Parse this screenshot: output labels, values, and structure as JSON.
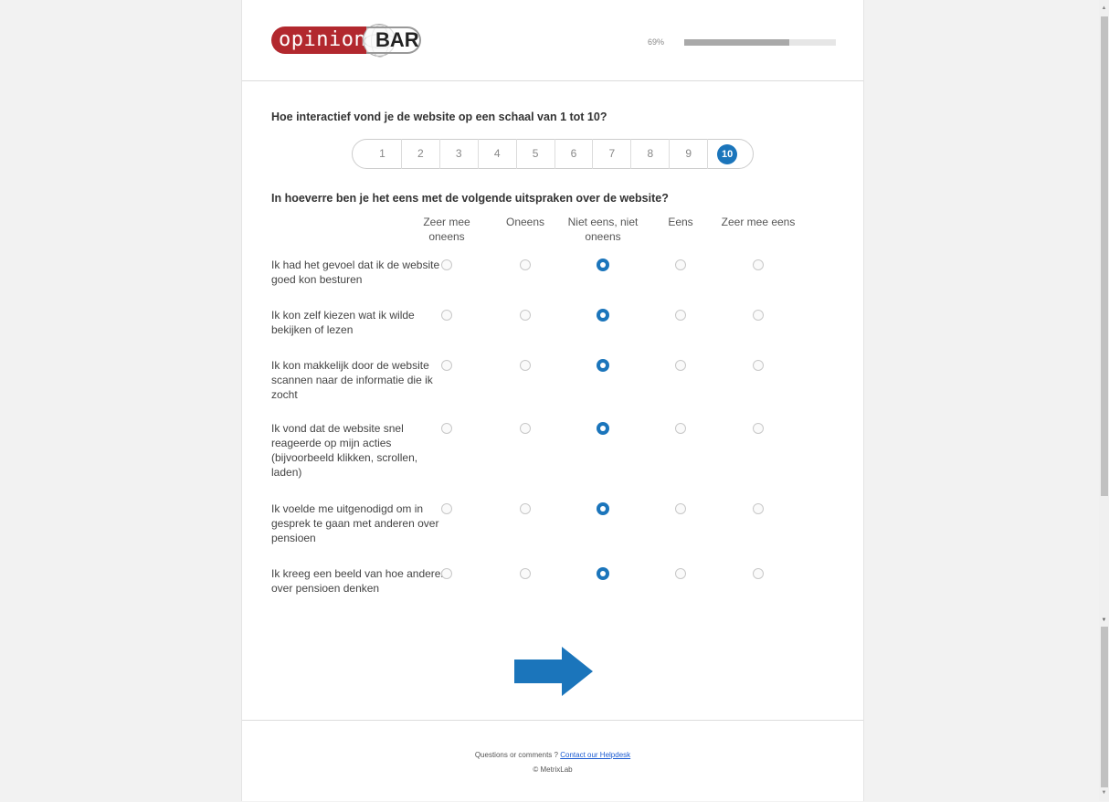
{
  "header": {
    "logo": {
      "word1": "opinion",
      "word2": "BAR"
    },
    "progress": {
      "label": "69%",
      "value": 0.69
    }
  },
  "question1": {
    "text": "Hoe interactief vond je de website op een schaal van 1 tot 10?",
    "options": [
      "1",
      "2",
      "3",
      "4",
      "5",
      "6",
      "7",
      "8",
      "9",
      "10"
    ],
    "selected": "10"
  },
  "question2": {
    "text": "In hoeverre ben je het eens met de volgende uitspraken over de website?",
    "columns": [
      "Zeer mee oneens",
      "Oneens",
      "Niet eens, niet oneens",
      "Eens",
      "Zeer mee eens"
    ],
    "rows": [
      {
        "label": "Ik had het gevoel dat ik de website goed kon besturen",
        "selected": 2
      },
      {
        "label": "Ik kon zelf kiezen wat ik wilde bekijken of lezen",
        "selected": 2
      },
      {
        "label": "Ik kon makkelijk door de website scannen naar de informatie die ik zocht",
        "selected": 2
      },
      {
        "label": "Ik vond dat de website snel reageerde op mijn acties (bijvoorbeeld klikken, scrollen, laden)",
        "selected": 2
      },
      {
        "label": "Ik voelde me uitgenodigd om in gesprek te gaan met anderen over pensioen",
        "selected": 2
      },
      {
        "label": "Ik kreeg een beeld van hoe anderen over pensioen denken",
        "selected": 2
      }
    ]
  },
  "navigation": {
    "next_icon": "right-arrow-icon"
  },
  "footer": {
    "text": "Questions or comments ?",
    "link": "Contact our Helpdesk",
    "copyright": "© MetrixLab"
  },
  "colors": {
    "accent": "#1b75bb",
    "brand_red": "#b2282e"
  }
}
